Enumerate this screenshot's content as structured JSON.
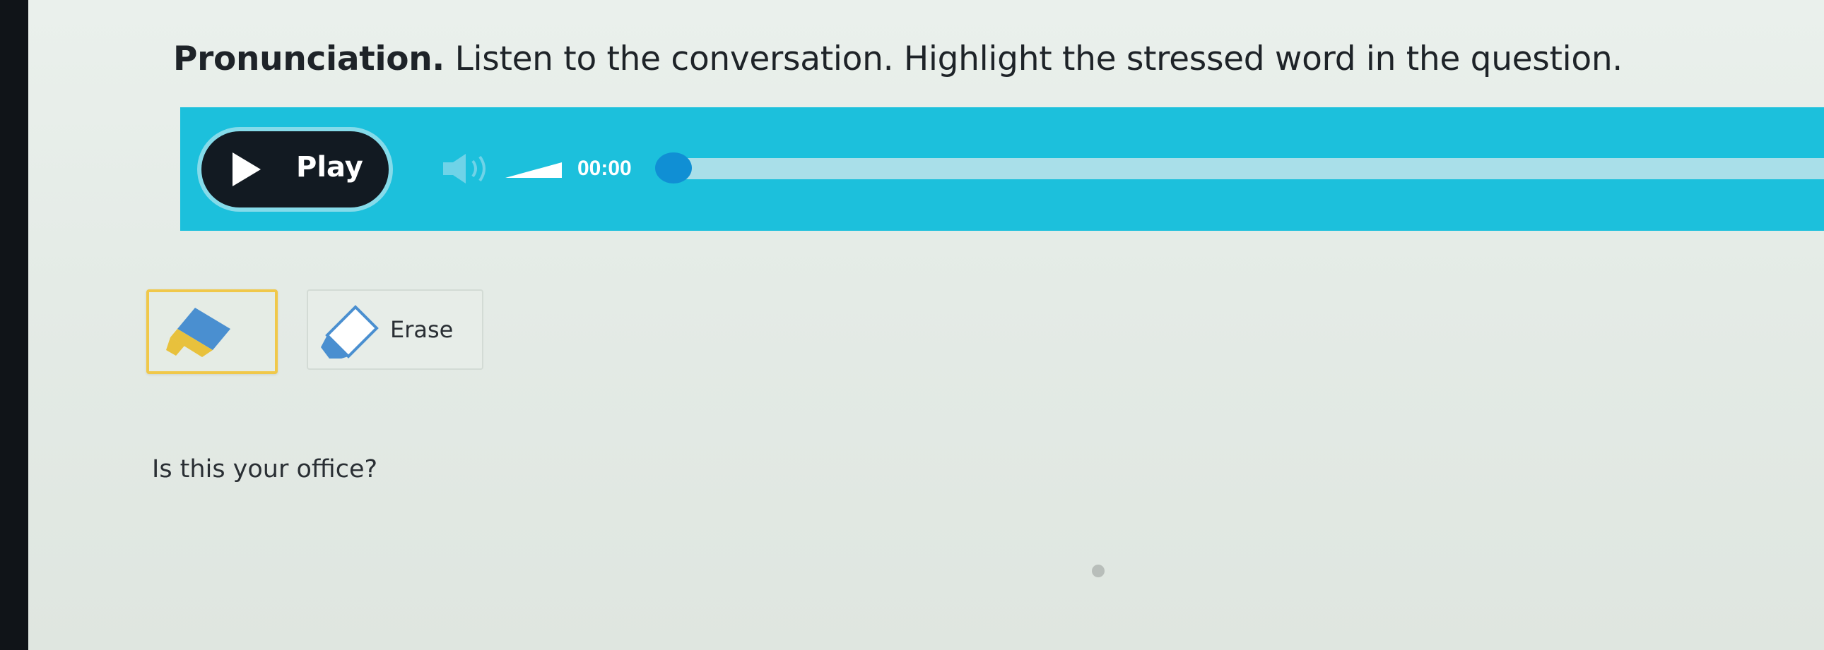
{
  "instruction": {
    "lead": "Pronunciation.",
    "text": "Listen to the conversation. Highlight the stressed word in the question."
  },
  "player": {
    "play_label": "Play",
    "time": "00:00",
    "progress": 0,
    "accent_color": "#1cc0dc",
    "knob_color": "#108fd4",
    "icons": {
      "play": "play-triangle-icon",
      "volume": "speaker-icon"
    }
  },
  "tools": {
    "highlight_icon": "highlighter-icon",
    "erase_icon": "eraser-icon",
    "erase_label": "Erase",
    "active_border_color": "#f0c84a"
  },
  "question": {
    "text": "Is this your office?"
  }
}
